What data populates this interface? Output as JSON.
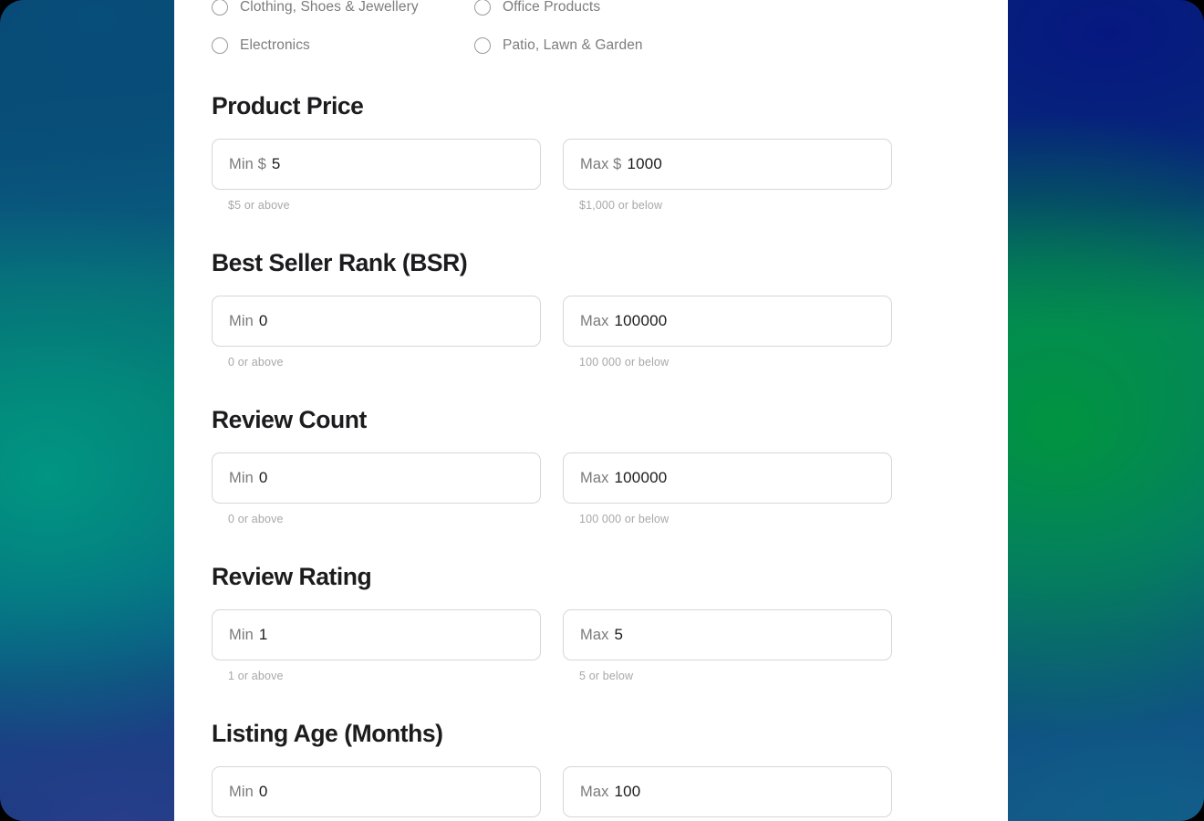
{
  "categories": {
    "items": [
      {
        "label": "Clothing, Shoes & Jewellery",
        "selected": false
      },
      {
        "label": "Office Products",
        "selected": false
      },
      {
        "label": "Electronics",
        "selected": false
      },
      {
        "label": "Patio, Lawn & Garden",
        "selected": false
      }
    ]
  },
  "sections": [
    {
      "title": "Product Price",
      "min": {
        "prefix": "Min $",
        "value": "5",
        "hint": "$5 or above"
      },
      "max": {
        "prefix": "Max $",
        "value": "1000",
        "hint": "$1,000 or below"
      }
    },
    {
      "title": "Best Seller Rank (BSR)",
      "min": {
        "prefix": "Min",
        "value": "0",
        "hint": "0 or above"
      },
      "max": {
        "prefix": "Max",
        "value": "100000",
        "hint": "100 000 or below"
      }
    },
    {
      "title": "Review Count",
      "min": {
        "prefix": "Min",
        "value": "0",
        "hint": "0 or above"
      },
      "max": {
        "prefix": "Max",
        "value": "100000",
        "hint": "100 000 or below"
      }
    },
    {
      "title": "Review Rating",
      "min": {
        "prefix": "Min",
        "value": "1",
        "hint": "1 or above"
      },
      "max": {
        "prefix": "Max",
        "value": "5",
        "hint": "5 or below"
      }
    },
    {
      "title": "Listing Age (Months)",
      "min": {
        "prefix": "Min",
        "value": "0",
        "hint": ""
      },
      "max": {
        "prefix": "Max",
        "value": "100",
        "hint": ""
      }
    }
  ],
  "colors": {
    "heading": "#1c1c1e",
    "label": "#7a7a7a",
    "hint": "#a8a8a8",
    "border": "#d6d6d6",
    "page_background": "#ffffff"
  }
}
